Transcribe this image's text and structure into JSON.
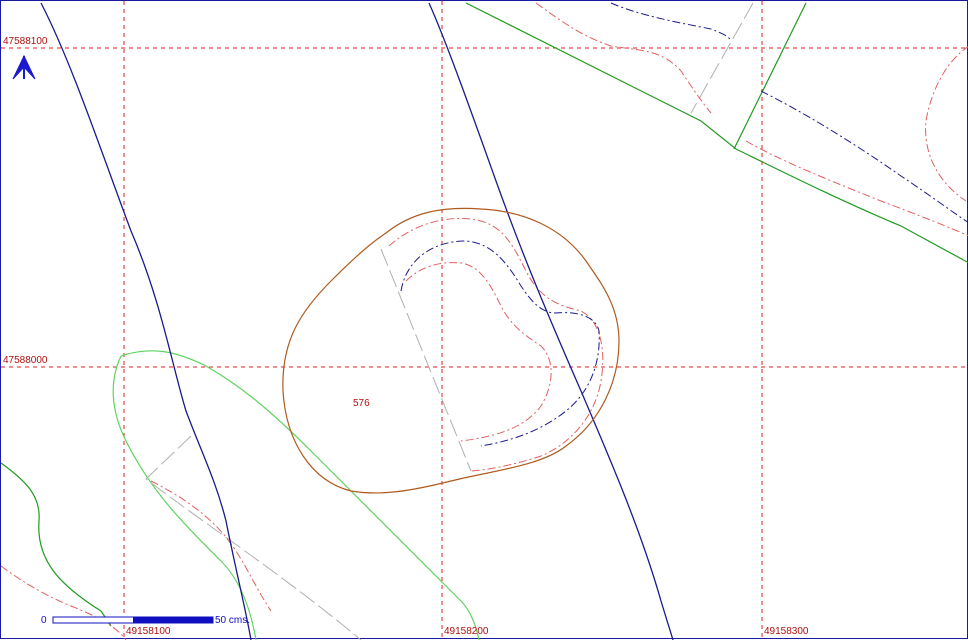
{
  "grid": {
    "northings": [
      "47588100",
      "47588000"
    ],
    "eastings": [
      "49158100",
      "49158200",
      "49158300"
    ]
  },
  "parcel": {
    "id": "576"
  },
  "scale_bar": {
    "start_label": "0",
    "end_label": "50 cms."
  },
  "colors": {
    "grid": "#dd2222",
    "road_blue": "#1a1a8c",
    "parcel_brown": "#b05a1e",
    "contour_red": "#e06060",
    "contour_blue": "#1a1a8c",
    "boundary_green": "#1f9a1f",
    "light_green": "#5fd35f",
    "gray_dash": "#b0b0b0",
    "north_arrow": "#1a1ad0"
  },
  "icons": {
    "north_arrow": "north-arrow-icon"
  }
}
